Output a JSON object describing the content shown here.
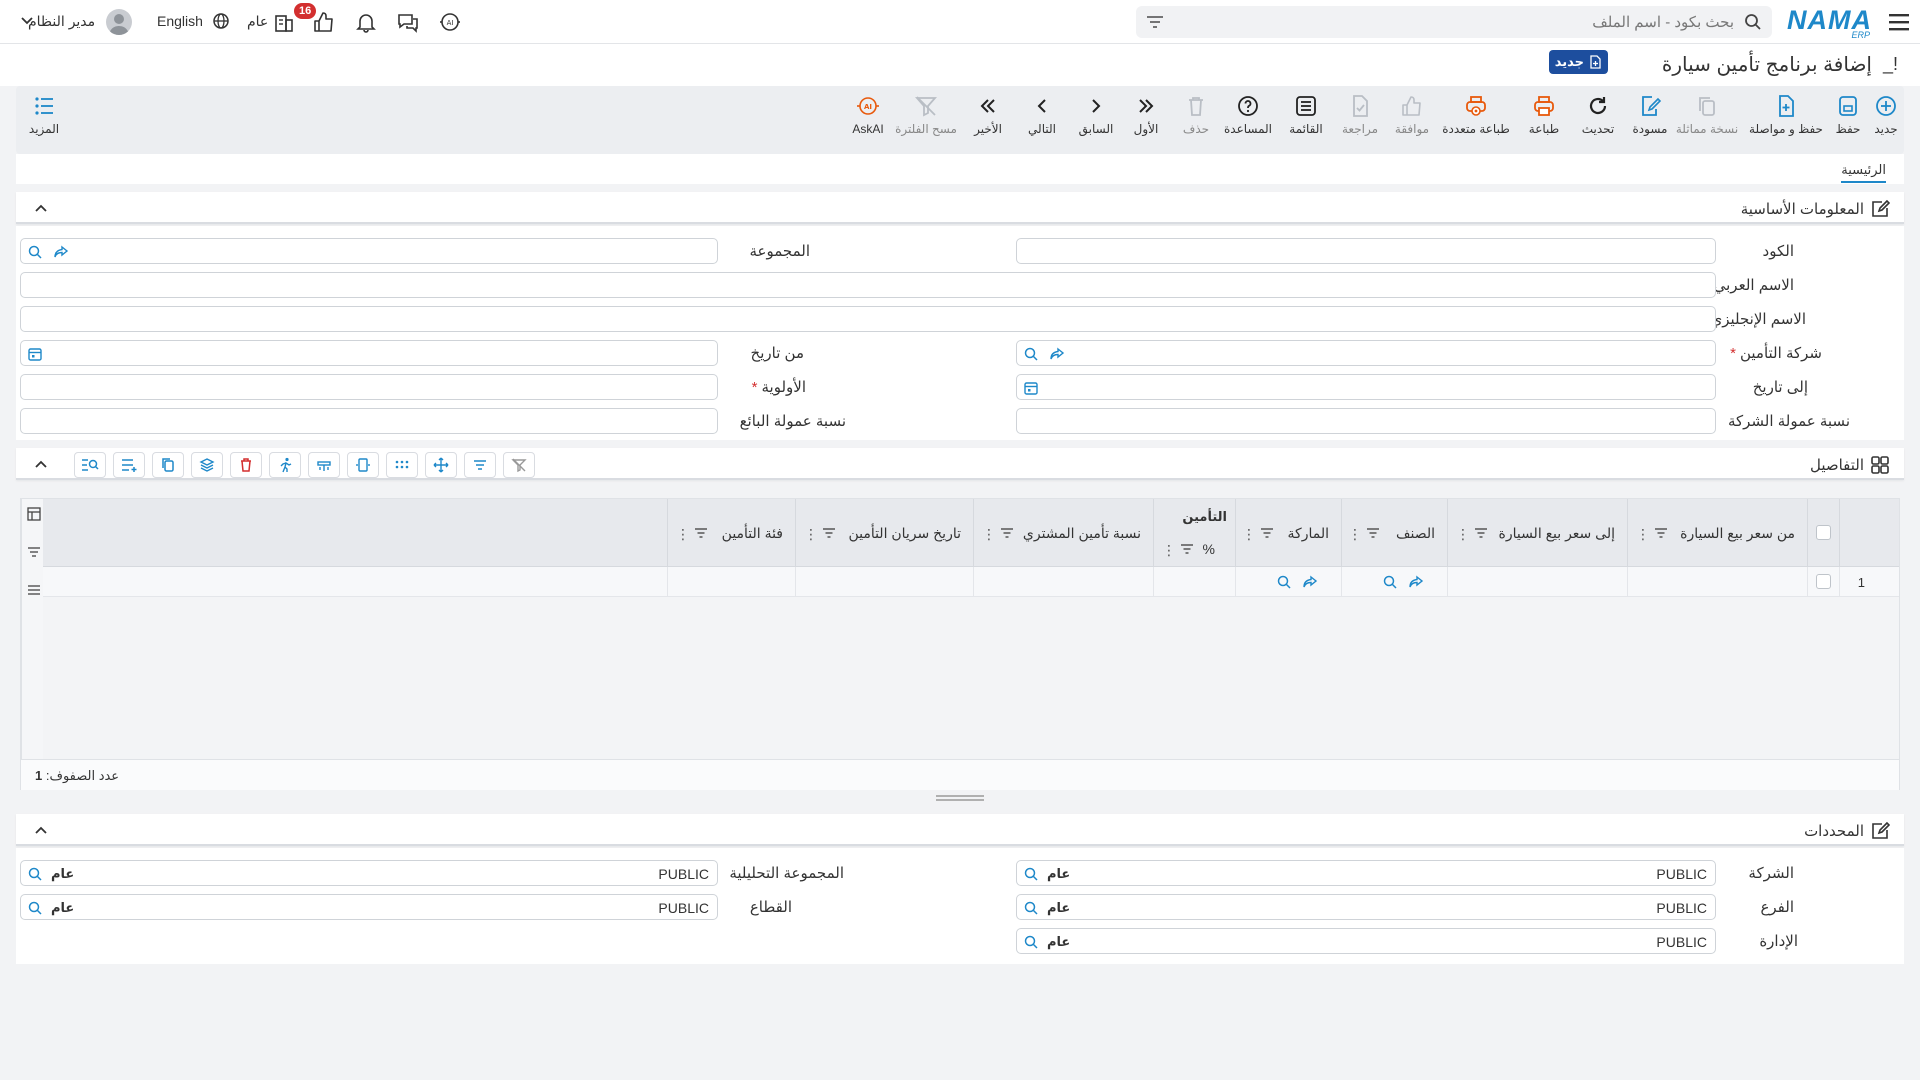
{
  "topbar": {
    "logo_text": "NAMA",
    "logo_sub": "ERP",
    "search_placeholder": "بحث بكود - اسم الملف",
    "notification_count": "16",
    "fiscal_label": "عام",
    "language": "English",
    "user_name": "مدير النظام"
  },
  "page": {
    "title_mark": "!_",
    "title": "إضافة برنامج تأمين سيارة",
    "status": "جديد"
  },
  "toolbar": {
    "new": "جديد",
    "save": "حفظ",
    "save_continue": "حفظ و مواصلة",
    "duplicate": "نسخة مماثلة",
    "draft": "مسودة",
    "refresh": "تحديث",
    "print": "طباعة",
    "multi_print": "طباعة متعددة",
    "approve": "موافقة",
    "review": "مراجعة",
    "list": "القائمة",
    "help": "المساعدة",
    "delete": "حذف",
    "first": "الأول",
    "prev": "السابق",
    "next": "التالي",
    "last": "الأخير",
    "clear_filter": "مسح الفلترة",
    "askai": "AskAI",
    "more": "المزيد"
  },
  "tabs": {
    "main": "الرئيسية"
  },
  "basic_info": {
    "title": "المعلومات الأساسية",
    "code": "الكود",
    "group": "المجموعة",
    "arabic_name": "الاسم العربي",
    "english_name": "الاسم الإنجليزي",
    "insurance_company": "شركة التأمين",
    "from_date": "من تاريخ",
    "to_date": "إلى تاريخ",
    "priority": "الأولوية",
    "company_commission": "نسبة عمولة الشركة",
    "seller_commission": "نسبة عمولة البائع",
    "required_mark": "*"
  },
  "details": {
    "title": "التفاصيل",
    "columns": {
      "from_price": "من سعر بيع السيارة",
      "to_price": "إلى سعر بيع السيارة",
      "item": "الصنف",
      "brand": "الماركة",
      "insurance_group": "التأمين",
      "percent": "%",
      "buyer_ratio": "نسبة تأمين المشتري",
      "validity_date": "تاريخ سريان التأمين",
      "category": "فئة التأمين"
    },
    "rows": [
      {
        "num": "1"
      }
    ],
    "row_count_label": "عدد الصفوف:",
    "row_count": "1"
  },
  "dimensions": {
    "title": "المحددات",
    "company": "الشركة",
    "analytic_group": "المجموعة التحليلية",
    "branch": "الفرع",
    "sector": "القطاع",
    "department": "الإدارة",
    "value": "PUBLIC",
    "tag": "عام"
  }
}
